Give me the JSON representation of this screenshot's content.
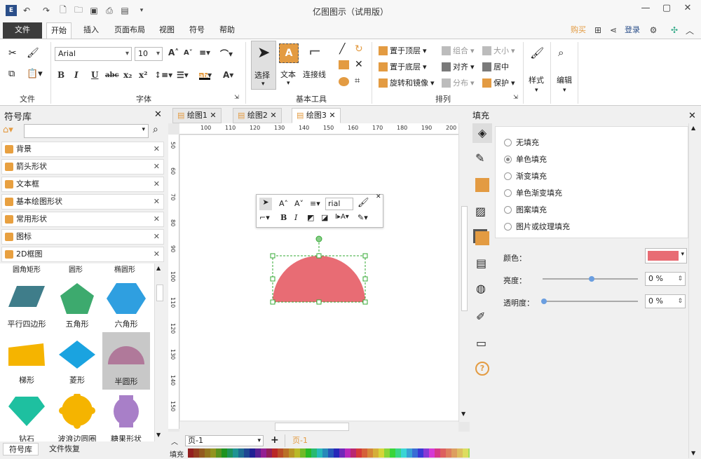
{
  "window": {
    "title": "亿图图示（试用版）"
  },
  "menu_tabs": [
    "文件",
    "开始",
    "插入",
    "页面布局",
    "视图",
    "符号",
    "帮助"
  ],
  "topright": {
    "buy": "购买",
    "login": "登录"
  },
  "ribbon": {
    "font_name": "Arial",
    "font_size": "10",
    "group_file": "文件",
    "group_font": "字体",
    "group_basic": "基本工具",
    "group_arrange": "排列",
    "select": "选择",
    "text": "文本",
    "connector": "连接线",
    "bring_front": "置于顶层",
    "send_back": "置于底层",
    "rotate_mirror": "旋转和镜像",
    "group": "组合",
    "size": "大小",
    "align": "对齐",
    "center": "居中",
    "distribute": "分布",
    "protect": "保护",
    "style": "样式",
    "edit": "编辑",
    "text_icon_letter": "A"
  },
  "library": {
    "title": "符号库",
    "categories": [
      "背景",
      "箭头形状",
      "文本框",
      "基本绘图形状",
      "常用形状",
      "图标",
      "2D框图"
    ],
    "partial_labels": [
      "圆角矩形",
      "圆形",
      "椭圆形"
    ],
    "shapes_row1": [
      "平行四边形",
      "五角形",
      "六角形"
    ],
    "shapes_row2": [
      "梯形",
      "菱形",
      "半圆形"
    ],
    "shapes_row3": [
      "钻石",
      "波浪边圆圈",
      "糖果形状"
    ],
    "bottom_tabs": [
      "符号库",
      "文件恢复"
    ]
  },
  "doc_tabs": [
    "绘图1",
    "绘图2",
    "绘图3"
  ],
  "ruler_h": [
    "100",
    "110",
    "120",
    "130",
    "140",
    "150",
    "160",
    "170",
    "180",
    "190",
    "200"
  ],
  "ruler_v": [
    "50",
    "60",
    "70",
    "80",
    "90",
    "100",
    "110",
    "120",
    "130",
    "140",
    "150"
  ],
  "floating_toolbar": {
    "font": "rial"
  },
  "page_bar": {
    "page_select": "页-1",
    "page_tab": "页-1"
  },
  "palette_label": "填充",
  "fill_panel": {
    "title": "填充",
    "options": [
      "无填充",
      "单色填充",
      "渐变填充",
      "单色渐变填充",
      "图案填充",
      "图片或纹理填充"
    ],
    "selected_option": 1,
    "color_label": "颜色：",
    "color_value": "#e86c74",
    "brightness_label": "亮度：",
    "brightness_value": "0 %",
    "transparency_label": "透明度：",
    "transparency_value": "0 %"
  },
  "colors": {
    "accent": "#e39b42",
    "shape_fill": "#e86c74",
    "selected_shape_bg": "#c8c8c8"
  }
}
